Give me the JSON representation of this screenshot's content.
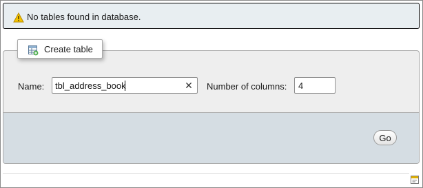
{
  "notice": {
    "icon": "warning-icon",
    "message": "No tables found in database."
  },
  "create_table": {
    "legend_icon": "table-add-icon",
    "legend_label": "Create table",
    "name_label": "Name:",
    "name_value": "tbl_address_book",
    "clear_symbol": "✕",
    "columns_label": "Number of columns:",
    "columns_value": "4",
    "go_label": "Go"
  },
  "footer": {
    "icon": "console-icon"
  },
  "colors": {
    "notice_bg": "#e8eef1",
    "fieldset_bg": "#eeeeee",
    "footer_bar_bg": "#d5dde3",
    "warning_yellow": "#f5c400"
  }
}
